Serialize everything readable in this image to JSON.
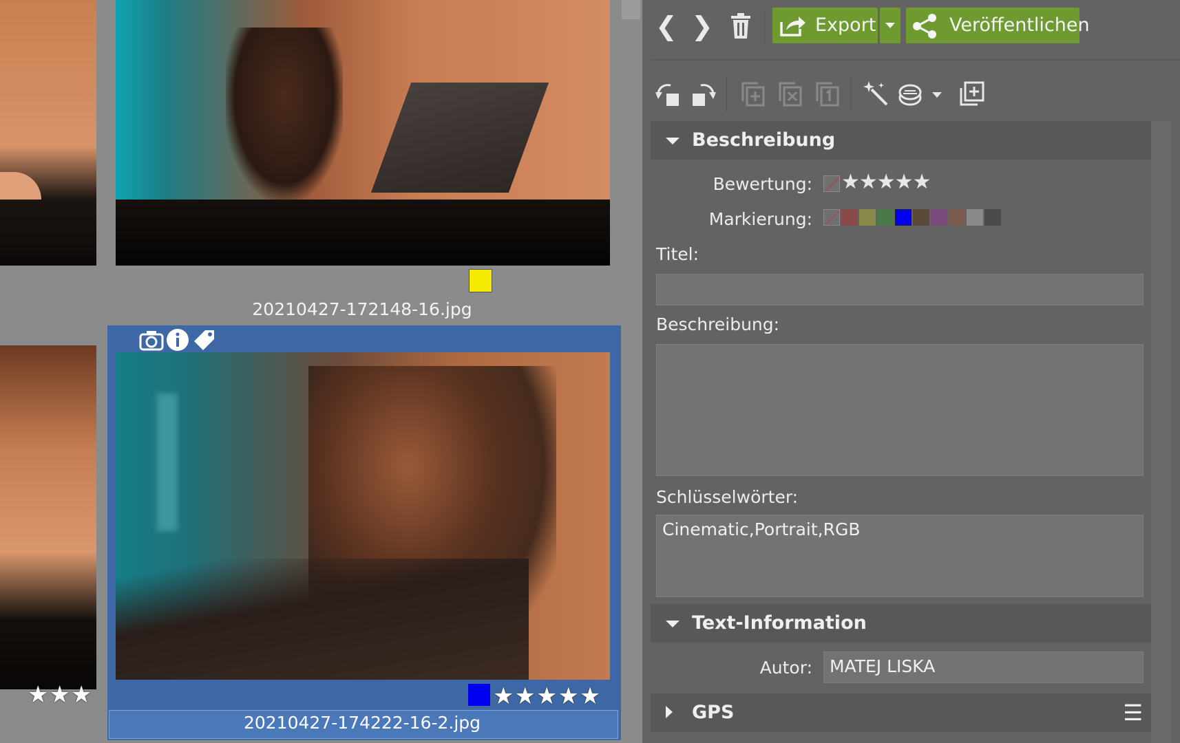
{
  "thumbnails": {
    "top_filename": "20210427-172148-16.jpg",
    "selected_filename": "20210427-174222-16-2.jpg",
    "left_rating_stars": "★★★",
    "selected_rating_stars": "★★★★★",
    "top_color_tag": "#f2ea00",
    "selected_color_tag": "#0000f0"
  },
  "toolbar": {
    "back_glyph": "❮",
    "forward_glyph": "❯",
    "export_label": "Export",
    "publish_label": "Veröffentlichen",
    "accent_green": "#6f9a2f"
  },
  "panel": {
    "section_description": "Beschreibung",
    "rating_label": "Bewertung:",
    "rating_stars": "★★★★★",
    "marking_label": "Markierung:",
    "marking_colors": [
      "#8a4a4a",
      "#8a8a4a",
      "#4a7a4a",
      "#0000f0",
      "#5a4a3a",
      "#7a4a7a",
      "#7a5a4a",
      "#8a8a8a",
      "#4a4a4a"
    ],
    "title_label": "Titel:",
    "title_value": "",
    "description_label": "Beschreibung:",
    "description_value": "",
    "keywords_label": "Schlüsselwörter:",
    "keywords_value": "Cinematic,Portrait,RGB",
    "section_text_info": "Text-Information",
    "author_label": "Autor:",
    "author_value": "MATEJ LISKA",
    "section_gps": "GPS",
    "menu_glyph": "☰"
  }
}
